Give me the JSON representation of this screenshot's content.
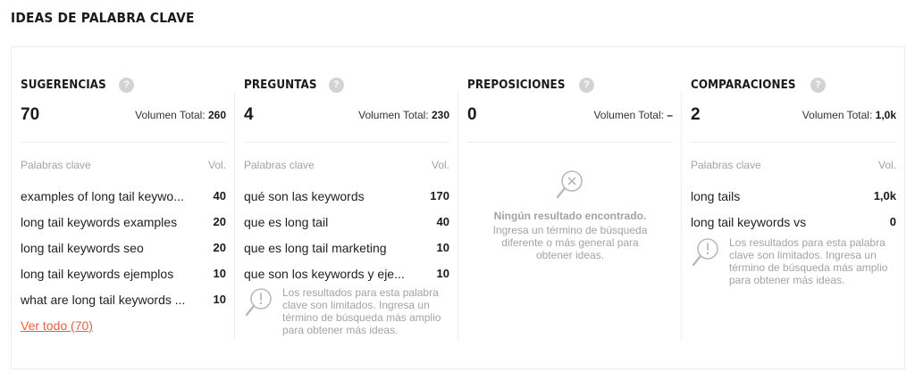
{
  "page_title": "IDEAS DE PALABRA CLAVE",
  "help_glyph": "?",
  "columns": [
    {
      "title": "SUGERENCIAS",
      "count": "70",
      "volume_label": "Volumen Total:",
      "volume_value": "260",
      "list_header_keyword": "Palabras clave",
      "list_header_volume": "Vol.",
      "rows": [
        {
          "keyword": "examples of long tail keywo...",
          "volume": "40"
        },
        {
          "keyword": "long tail keywords examples",
          "volume": "20"
        },
        {
          "keyword": "long tail keywords seo",
          "volume": "20"
        },
        {
          "keyword": "long tail keywords ejemplos",
          "volume": "10"
        },
        {
          "keyword": "what are long tail keywords ...",
          "volume": "10"
        }
      ],
      "see_all": "Ver todo (70)"
    },
    {
      "title": "PREGUNTAS",
      "count": "4",
      "volume_label": "Volumen Total:",
      "volume_value": "230",
      "list_header_keyword": "Palabras clave",
      "list_header_volume": "Vol.",
      "rows": [
        {
          "keyword": "qué son las keywords",
          "volume": "170"
        },
        {
          "keyword": "que es long tail",
          "volume": "40"
        },
        {
          "keyword": "que es long tail marketing",
          "volume": "10"
        },
        {
          "keyword": "que son los keywords y eje...",
          "volume": "10"
        }
      ],
      "notice": "Los resultados para esta palabra clave son limitados. Ingresa un término de búsqueda más amplio para obtener más ideas."
    },
    {
      "title": "PREPOSICIONES",
      "count": "0",
      "volume_label": "Volumen Total:",
      "volume_value": "–",
      "empty_title": "Ningún resultado encontrado.",
      "empty_desc": "Ingresa un término de búsqueda diferente o más general para obtener ideas."
    },
    {
      "title": "COMPARACIONES",
      "count": "2",
      "volume_label": "Volumen Total:",
      "volume_value": "1,0k",
      "list_header_keyword": "Palabras clave",
      "list_header_volume": "Vol.",
      "rows": [
        {
          "keyword": "long tails",
          "volume": "1,0k"
        },
        {
          "keyword": "long tail keywords vs",
          "volume": "0"
        }
      ],
      "notice": "Los resultados para esta palabra clave son limitados. Ingresa un término de búsqueda más amplio para obtener más ideas."
    }
  ],
  "colors": {
    "accent": "#e8613c",
    "muted": "#a3a3a3",
    "help_icon": "#d3d3d3",
    "border": "#ececec"
  },
  "icons": {
    "help": "question-icon",
    "notice": "search-alert-icon",
    "empty": "search-x-icon"
  }
}
